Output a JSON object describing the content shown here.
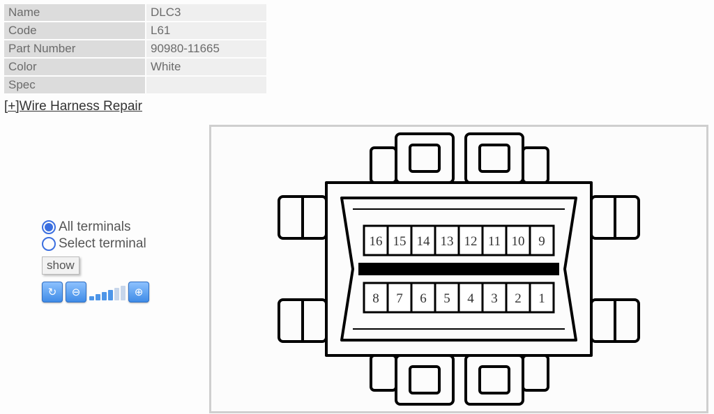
{
  "info": {
    "rows": [
      {
        "k": "Name",
        "v": "DLC3"
      },
      {
        "k": "Code",
        "v": "L61"
      },
      {
        "k": "Part Number",
        "v": "90980-11665"
      },
      {
        "k": "Color",
        "v": "White"
      },
      {
        "k": "Spec",
        "v": ""
      }
    ]
  },
  "repair_link": "[+]Wire Harness Repair",
  "controls": {
    "radio_all": "All terminals",
    "radio_select": "Select terminal",
    "show": "show"
  },
  "toolbar": {
    "reset": "↻",
    "zoom_out": "⊖",
    "zoom_in": "⊕"
  },
  "connector": {
    "top_row": [
      "16",
      "15",
      "14",
      "13",
      "12",
      "11",
      "10",
      "9"
    ],
    "bottom_row": [
      "8",
      "7",
      "6",
      "5",
      "4",
      "3",
      "2",
      "1"
    ]
  }
}
